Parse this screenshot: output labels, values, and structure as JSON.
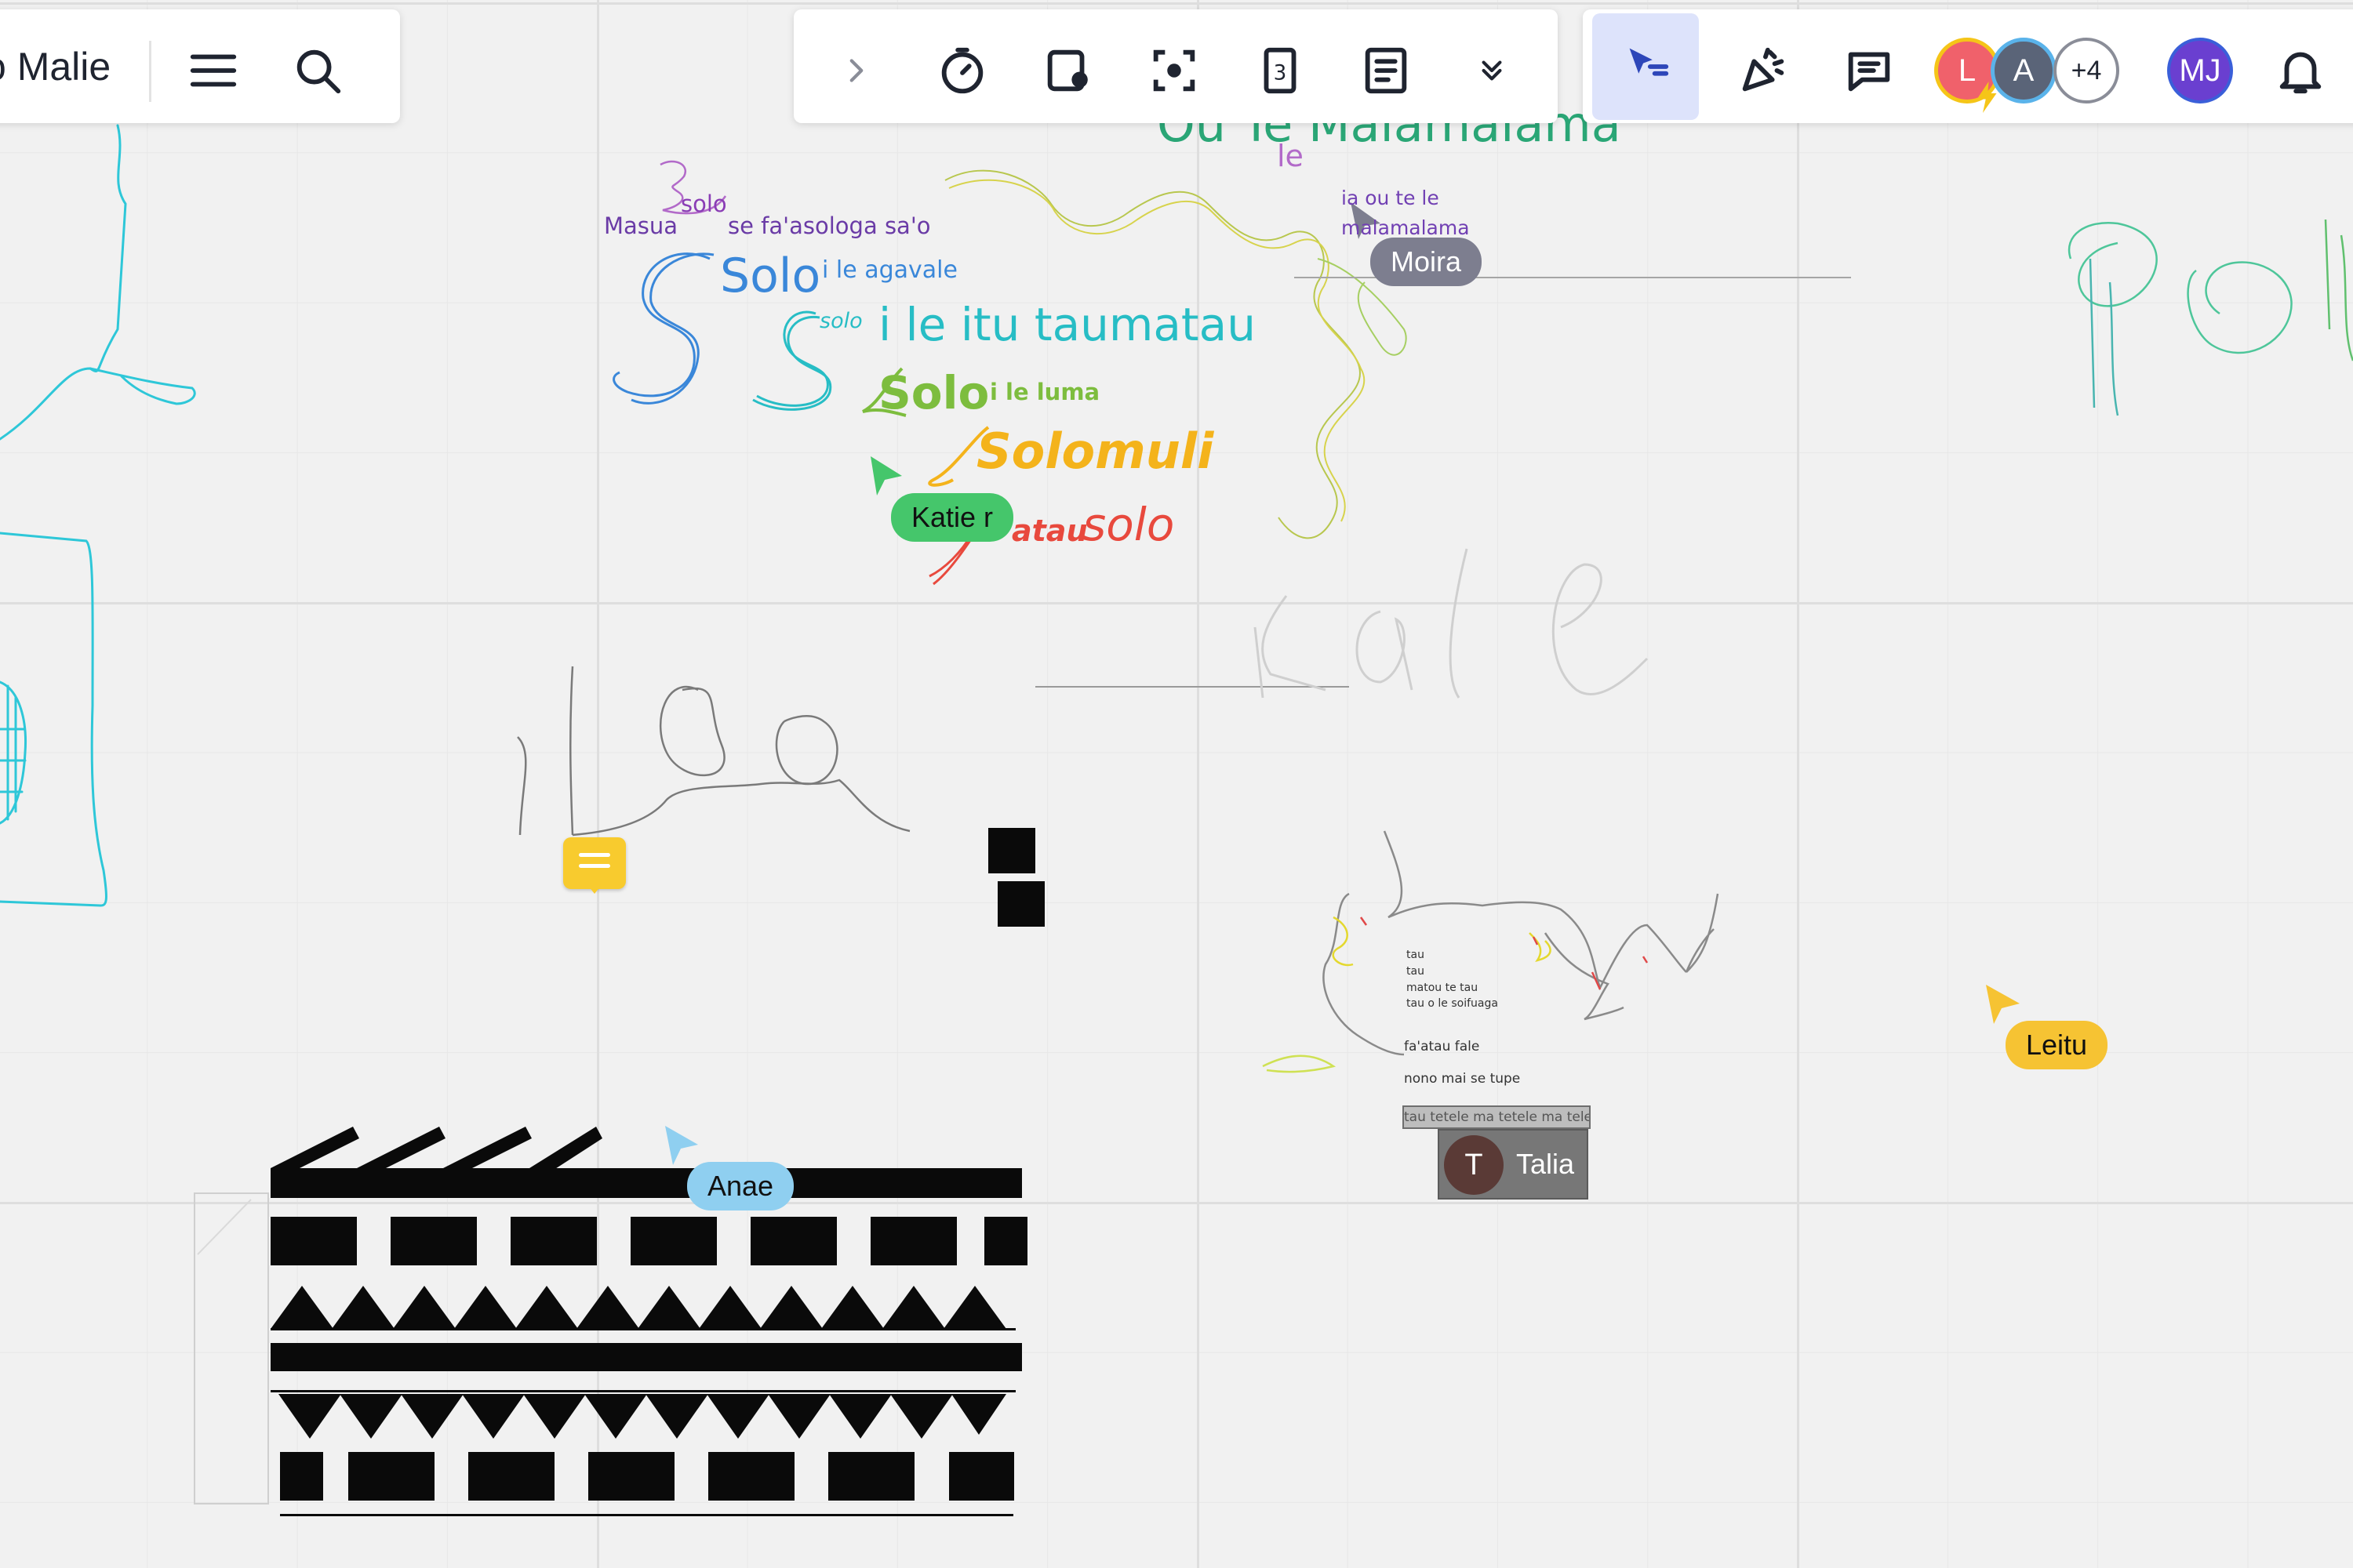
{
  "board": {
    "title": "o Malie"
  },
  "toolbar": {
    "left": {
      "menu_icon": "hamburger-menu-icon",
      "search_icon": "search-icon"
    },
    "center": [
      "chevron-right-icon",
      "timer-icon",
      "card-icon",
      "focus-frame-icon",
      "numbered-page-icon",
      "notes-icon",
      "expand-more-icon"
    ],
    "right": [
      "presenter-cursor-icon",
      "celebrate-icon",
      "comment-icon"
    ]
  },
  "collaborators": {
    "avatars": [
      {
        "initial": "L",
        "color": "#f0616b",
        "ring": "#f5c518"
      },
      {
        "initial": "A",
        "color": "#5a6478",
        "ring": "#5ab3ea"
      }
    ],
    "more": "+4",
    "me": {
      "initial": "MJ",
      "color": "#6a3fd0"
    }
  },
  "canvas_text": {
    "heading_top": "Ou Te Malamalama",
    "le": "le",
    "solo_small": "solo",
    "masua": "Masua",
    "se_faasologa": "se fa'asologa sa'o",
    "solo_blue": "Solo",
    "i_le_agavale": "i le agavale",
    "solo_teal_small": "solo",
    "i_le_itu": "i le itu taumatau",
    "solo_green": "Solo",
    "i_le_luma": "i le luma",
    "solomuli": "Solomuli",
    "atau": "atau",
    "solo_red": "solo",
    "ia_ou": "ia ou te le",
    "malamalama": "malamalama",
    "kale": "Kale",
    "tau1": "tau",
    "tau2": "tau",
    "matou": "matou te tau",
    "tau_o_le": "tau o le soifuaga",
    "faatau": "fa'atau fale",
    "nono": "nono mai se tupe",
    "tau_tetele": "tau tetele ma tetele ma tele"
  },
  "cursors": [
    {
      "name": "Moira",
      "color": "#7d7e8f"
    },
    {
      "name": "Katie r",
      "color": "#45c66b"
    },
    {
      "name": "Leitu",
      "color": "#f6c333"
    },
    {
      "name": "Anae",
      "color": "#8fcff0"
    },
    {
      "name": "Talia",
      "initial": "T",
      "color": "#6e6e6e"
    }
  ],
  "comment_marker": "comment-note-icon"
}
